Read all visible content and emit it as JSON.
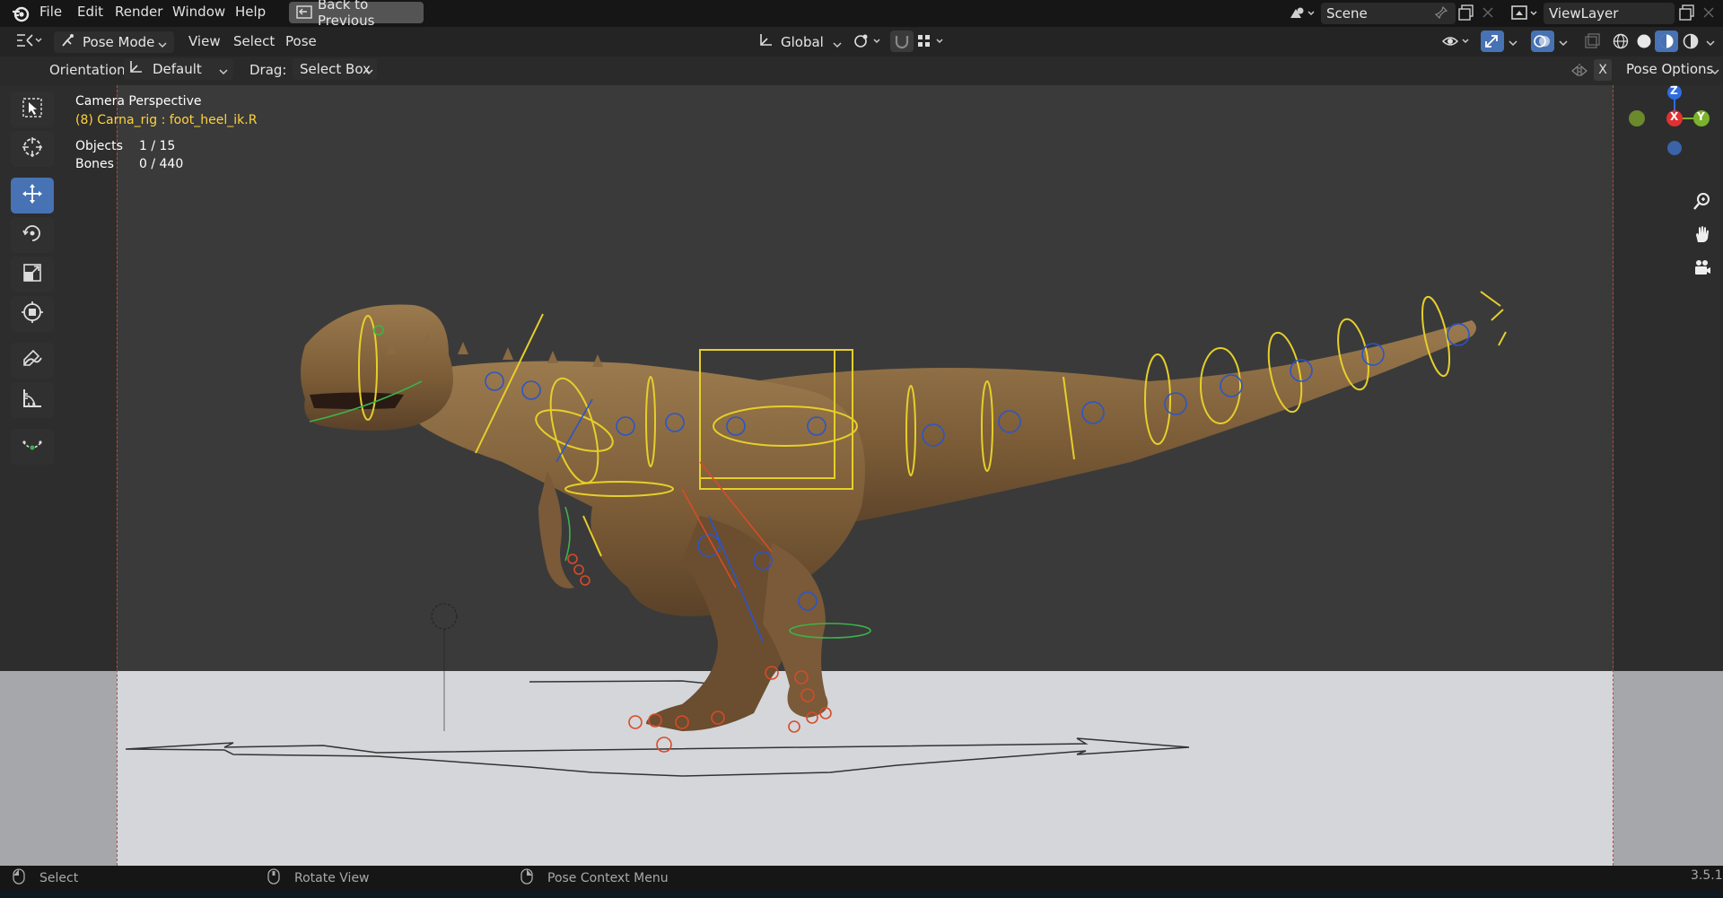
{
  "menu": {
    "items": [
      "File",
      "Edit",
      "Render",
      "Window",
      "Help"
    ],
    "back_button": "Back to Previous"
  },
  "scene": {
    "name": "Scene"
  },
  "view_layer": {
    "name": "ViewLayer"
  },
  "header": {
    "mode": "Pose Mode",
    "menus": [
      "View",
      "Select",
      "Pose"
    ],
    "transform_orientation": "Global"
  },
  "tool_settings": {
    "orientation_label": "Orientation:",
    "orientation_value": "Default",
    "drag_label": "Drag:",
    "drag_value": "Select Box",
    "pose_options": "Pose Options",
    "x_toggle": "X"
  },
  "overlay": {
    "view_name": "Camera Perspective",
    "active_object": "(8) Carna_rig : foot_heel_ik.R",
    "objects_label": "Objects",
    "objects_value": "1 / 15",
    "bones_label": "Bones",
    "bones_value": "0 / 440"
  },
  "gizmo": {
    "z": "Z",
    "x": "X",
    "y": "Y"
  },
  "statusbar": {
    "select": "Select",
    "rotate_view": "Rotate View",
    "context_menu": "Pose Context Menu",
    "version": "3.5.1"
  },
  "colors": {
    "accent": "#4772b3",
    "rig_yellow": "#e6cf2a",
    "rig_blue": "#2b55c9",
    "rig_red": "#d74b28",
    "rig_green": "#3bb34a",
    "active_text": "#ffd33a"
  }
}
